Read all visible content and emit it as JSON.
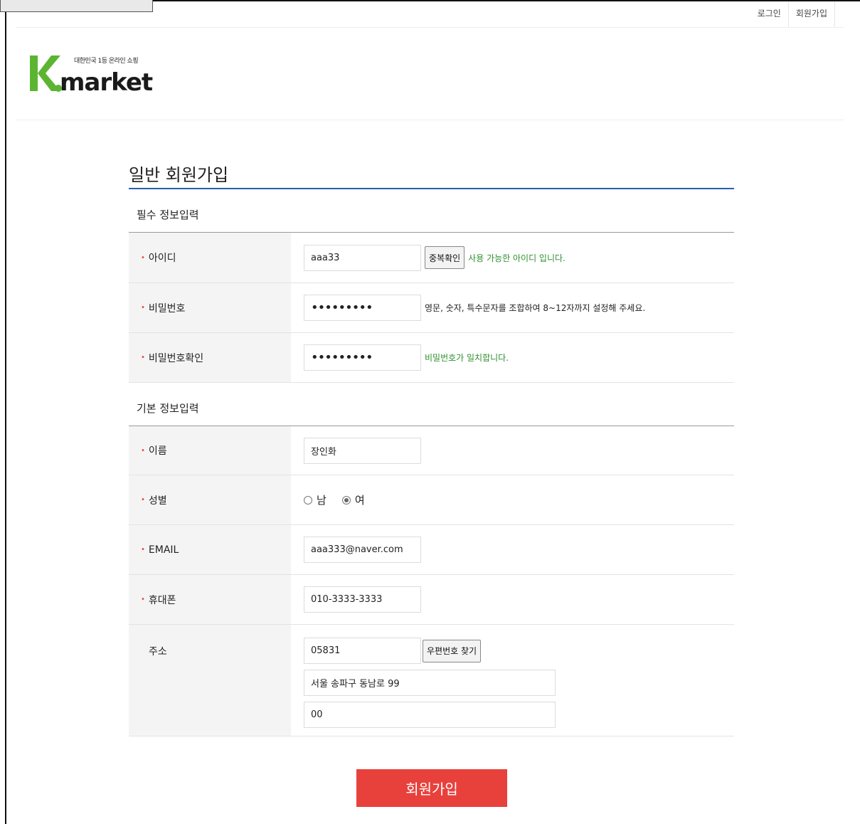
{
  "header": {
    "login": "로그인",
    "signup": "회원가입",
    "logo_tagline": "대한민국 1등 온라인 쇼핑",
    "logo_text": "Kmarket"
  },
  "page_title": "일반 회원가입",
  "section_required": {
    "title": "필수 정보입력",
    "id_label": "아이디",
    "id_value": "aaa33",
    "dup_check_button": "중복확인",
    "id_message": "사용 가능한 아이디 입니다.",
    "pw_label": "비밀번호",
    "pw_value": "•••••••••",
    "pw_hint": "영문, 숫자, 특수문자를 조합하여 8~12자까지 설정해 주세요.",
    "pw_confirm_label": "비밀번호확인",
    "pw_confirm_value": "•••••••••",
    "pw_confirm_message": "비밀번호가 일치합니다."
  },
  "section_basic": {
    "title": "기본 정보입력",
    "name_label": "이름",
    "name_value": "장인화",
    "gender_label": "성별",
    "gender_male": "남",
    "gender_female": "여",
    "gender_selected": "여",
    "email_label": "EMAIL",
    "email_value": "aaa333@naver.com",
    "phone_label": "휴대폰",
    "phone_value": "010-3333-3333",
    "address_label": "주소",
    "zip_value": "05831",
    "zip_button": "우편번호 찾기",
    "address1_value": "서울 송파구 동남로 99",
    "address2_value": "00"
  },
  "submit_button": "회원가입",
  "colors": {
    "accent_red": "#e8413c",
    "title_rule_blue": "#2a5db0",
    "ok_green": "#2f8f2f",
    "logo_green": "#5cb531",
    "logo_dark": "#1a1a1a"
  }
}
